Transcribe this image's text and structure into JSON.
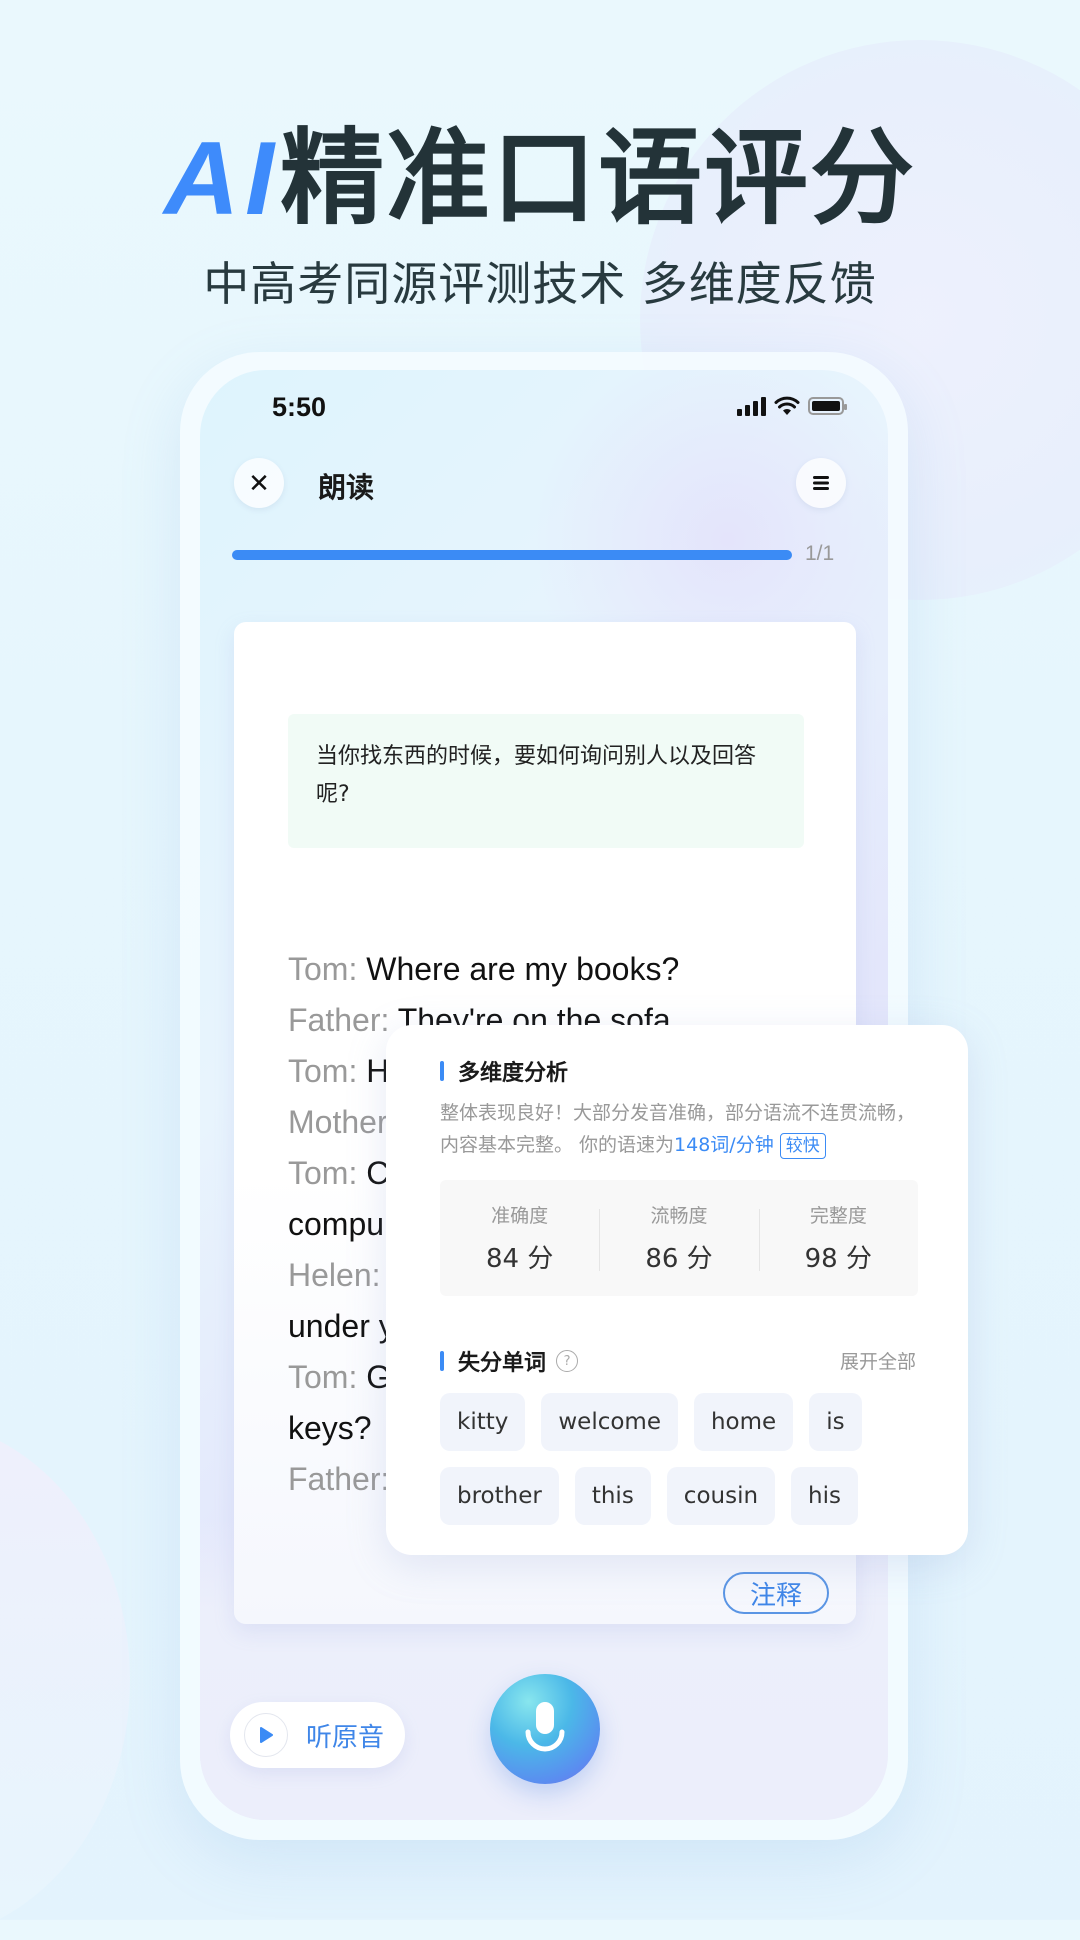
{
  "hero": {
    "title_accent": "AI",
    "title_main": "精准口语评分",
    "subtitle": "中高考同源评测技术 多维度反馈"
  },
  "status_bar": {
    "time": "5:50",
    "icons": [
      "signal-icon",
      "wifi-icon",
      "battery-icon"
    ]
  },
  "nav": {
    "close_icon": "✕",
    "title": "朗读",
    "menu_icon": "≡"
  },
  "progress": {
    "fraction": 1.0,
    "label": "1/1"
  },
  "prompt": {
    "text": "当你找东西的时候，要如何询问别人以及回答呢?"
  },
  "dialogue": [
    {
      "speaker": "Tom:",
      "text": " Where are my books?"
    },
    {
      "speaker": "Father:",
      "text": " They're on the sofa."
    },
    {
      "speaker": "Tom:",
      "text": " H"
    },
    {
      "speaker": "Mother",
      "text": ""
    },
    {
      "speaker": "Tom:",
      "text": " C"
    },
    {
      "speaker": "",
      "text": "compu"
    },
    {
      "speaker": "Helen:",
      "text": ""
    },
    {
      "speaker": "",
      "text": "under y"
    },
    {
      "speaker": "Tom:",
      "text": " G"
    },
    {
      "speaker": "",
      "text": "keys?"
    },
    {
      "speaker": "Father:",
      "text": ""
    }
  ],
  "note_button": "注释",
  "bottom": {
    "listen_label": "听原音",
    "mic_icon": "microphone-icon"
  },
  "analysis": {
    "title": "多维度分析",
    "summary_prefix": "整体表现良好！大部分发音准确，部分语流不连贯流畅，内容基本完整。 你的语速为",
    "speed": "148词/分钟",
    "speed_tag": "较快",
    "scores": [
      {
        "label": "准确度",
        "value": "84 分"
      },
      {
        "label": "流畅度",
        "value": "86 分"
      },
      {
        "label": "完整度",
        "value": "98 分"
      }
    ]
  },
  "lost_words": {
    "title": "失分单词",
    "help_icon": "?",
    "expand_label": "展开全部",
    "words": [
      "kitty",
      "welcome",
      "home",
      "is",
      "brother",
      "this",
      "cousin",
      "his"
    ]
  },
  "colors": {
    "accent": "#3b8bf5",
    "title_dark": "#233338",
    "prompt_bg": "#f1fbf6",
    "chip_bg": "#f1f4fb"
  }
}
